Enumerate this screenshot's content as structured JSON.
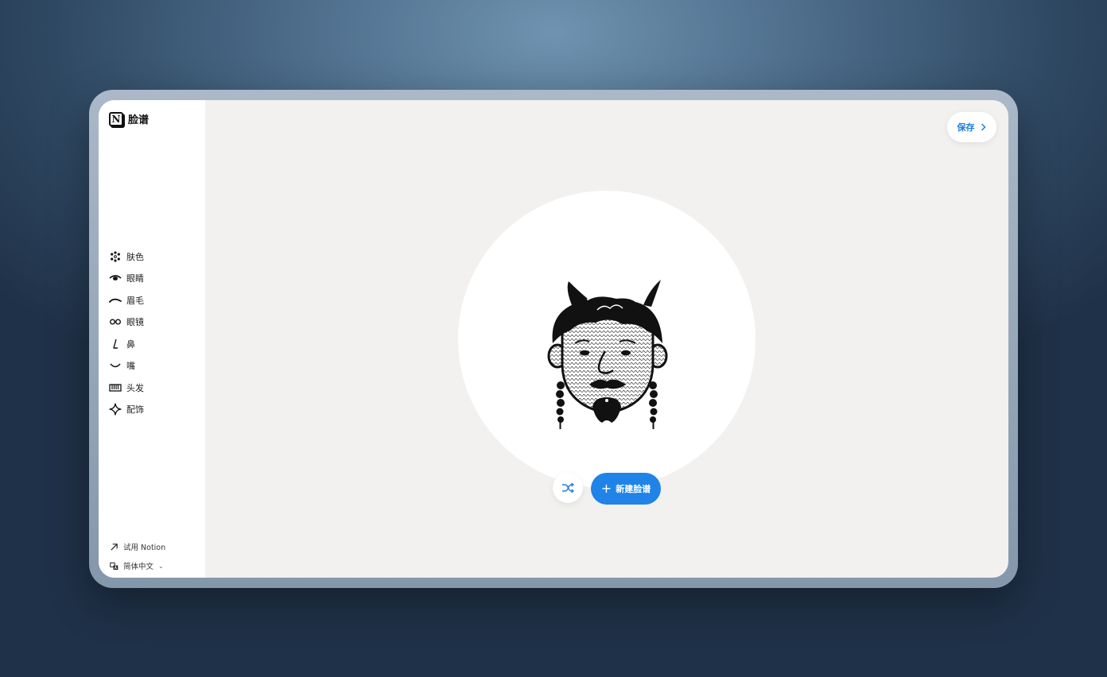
{
  "app": {
    "title": "脸谱"
  },
  "sidebar": {
    "items": [
      {
        "label": "肤色",
        "icon": "palette-dots-icon"
      },
      {
        "label": "眼睛",
        "icon": "eye-icon"
      },
      {
        "label": "眉毛",
        "icon": "eyebrow-icon"
      },
      {
        "label": "眼镜",
        "icon": "glasses-icon"
      },
      {
        "label": "鼻",
        "icon": "nose-icon"
      },
      {
        "label": "嘴",
        "icon": "mouth-icon"
      },
      {
        "label": "头发",
        "icon": "hair-comb-icon"
      },
      {
        "label": "配饰",
        "icon": "sparkle-icon"
      }
    ],
    "footer": {
      "try_label": "试用 Notion",
      "language_label": "简体中文"
    }
  },
  "header": {
    "save_label": "保存"
  },
  "actions": {
    "new_label": "新建脸谱"
  },
  "colors": {
    "accent": "#1f83e8",
    "canvas": "#f2f1ef",
    "sidebar": "#ffffff"
  }
}
